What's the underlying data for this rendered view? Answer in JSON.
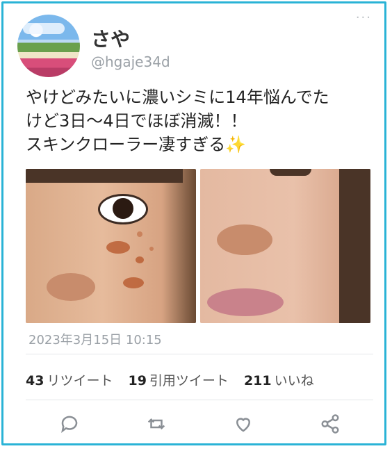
{
  "user": {
    "name": "さや",
    "handle": "@hgaje34d"
  },
  "more_label": "···",
  "tweet": {
    "lines": [
      "やけどみたいに濃いシミに14年悩んでた",
      "けど3日〜4日でほぼ消滅！！",
      "スキンクローラー凄すぎる"
    ],
    "emoji": "✨"
  },
  "timestamp": "2023年3月15日 10:15",
  "stats": {
    "retweets_count": "43",
    "retweets_label": "リツイート",
    "quotes_count": "19",
    "quotes_label": "引用ツイート",
    "likes_count": "211",
    "likes_label": "いいね"
  },
  "colors": {
    "frame": "#2ab3d6",
    "muted": "#9aa0a6"
  },
  "icons": [
    "reply-icon",
    "retweet-icon",
    "like-icon",
    "share-icon"
  ]
}
